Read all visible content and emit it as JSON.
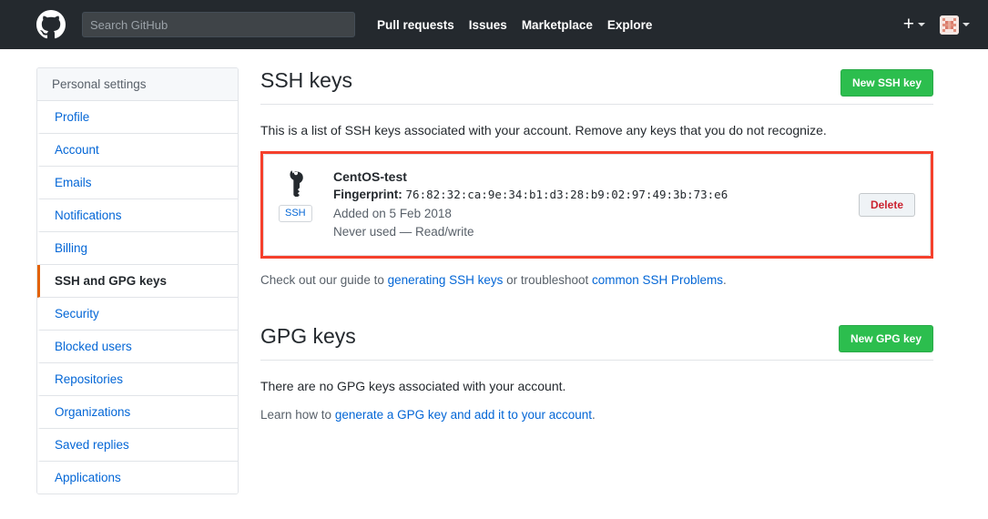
{
  "header": {
    "logo_icon": "github-octocat-icon",
    "search": {
      "placeholder": "Search GitHub",
      "value": ""
    },
    "nav": [
      {
        "label": "Pull requests"
      },
      {
        "label": "Issues"
      },
      {
        "label": "Marketplace"
      },
      {
        "label": "Explore"
      }
    ],
    "create_new_icon": "plus-icon",
    "avatar_icon": "user-avatar-identicon",
    "background_color": "#24292e"
  },
  "sidebar": {
    "title": "Personal settings",
    "items": [
      {
        "label": "Profile",
        "selected": false
      },
      {
        "label": "Account",
        "selected": false
      },
      {
        "label": "Emails",
        "selected": false
      },
      {
        "label": "Notifications",
        "selected": false
      },
      {
        "label": "Billing",
        "selected": false
      },
      {
        "label": "SSH and GPG keys",
        "selected": true
      },
      {
        "label": "Security",
        "selected": false
      },
      {
        "label": "Blocked users",
        "selected": false
      },
      {
        "label": "Repositories",
        "selected": false
      },
      {
        "label": "Organizations",
        "selected": false
      },
      {
        "label": "Saved replies",
        "selected": false
      },
      {
        "label": "Applications",
        "selected": false
      }
    ],
    "selected_accent_color": "#e36209",
    "link_color": "#0366d6"
  },
  "ssh_section": {
    "heading": "SSH keys",
    "new_button_label": "New SSH key",
    "new_button_color": "#2cbe4e",
    "description": "This is a list of SSH keys associated with your account. Remove any keys that you do not recognize.",
    "highlight_color": "#f5402c",
    "key": {
      "icon": "key-icon",
      "badge": "SSH",
      "title": "CentOS-test",
      "fingerprint_label": "Fingerprint:",
      "fingerprint_value": "76:82:32:ca:9e:34:b1:d3:28:b9:02:97:49:3b:73:e6",
      "added_on": "Added on 5 Feb 2018",
      "usage": "Never used — Read/write",
      "delete_label": "Delete",
      "delete_color": "#cb2431"
    },
    "guide_prefix": "Check out our guide to ",
    "guide_link_1": "generating SSH keys",
    "guide_middle": " or troubleshoot ",
    "guide_link_2": "common SSH Problems",
    "guide_suffix": "."
  },
  "gpg_section": {
    "heading": "GPG keys",
    "new_button_label": "New GPG key",
    "empty_text": "There are no GPG keys associated with your account.",
    "learn_prefix": "Learn how to ",
    "learn_link": "generate a GPG key and add it to your account",
    "learn_suffix": "."
  }
}
